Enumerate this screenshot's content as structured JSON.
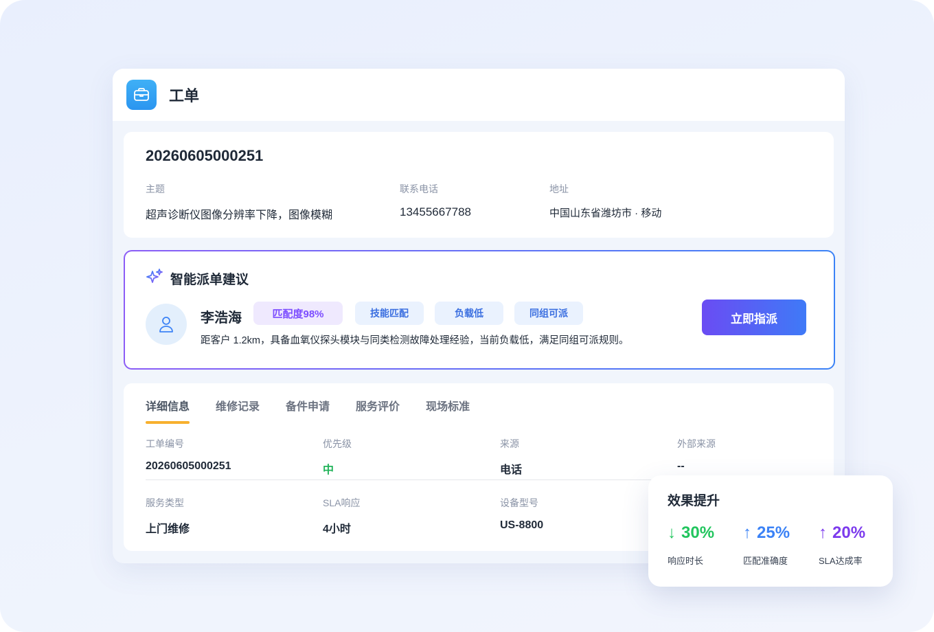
{
  "window": {
    "title": "工单"
  },
  "ticket": {
    "number": "20260605000251",
    "fields": [
      {
        "label": "主题",
        "value": "超声诊断仪图像分辨率下降，图像模糊"
      },
      {
        "label": "联系电话",
        "value": "13455667788"
      },
      {
        "label": "地址",
        "value": "中国山东省潍坊市 · 移动"
      }
    ]
  },
  "ai": {
    "title": "智能派单建议",
    "person": "李浩海",
    "match": "匹配度98%",
    "tags": [
      "技能匹配",
      "负载低",
      "同组可派"
    ],
    "description": "距客户 1.2km，具备血氧仪探头模块与同类检测故障处理经验，当前负载低，满足同组可派规则。",
    "button": "立即指派"
  },
  "tabs": [
    "详细信息",
    "维修记录",
    "备件申请",
    "服务评价",
    "现场标准"
  ],
  "details": {
    "row1": [
      {
        "label": "工单编号",
        "value": "20260605000251"
      },
      {
        "label": "优先级",
        "value": "中"
      },
      {
        "label": "来源",
        "value": "电话"
      },
      {
        "label": "外部来源",
        "value": "--"
      }
    ],
    "row2": [
      {
        "label": "服务类型",
        "value": "上门维修"
      },
      {
        "label": "SLA响应",
        "value": "4小时"
      },
      {
        "label": "设备型号",
        "value": "US-8800"
      }
    ]
  },
  "effect": {
    "title": "效果提升",
    "metrics": [
      {
        "arrow": "↓",
        "value": "30%",
        "label": "响应时长",
        "color": "#22c55e"
      },
      {
        "arrow": "↑",
        "value": "25%",
        "label": "匹配准确度",
        "color": "#3b82f6"
      },
      {
        "arrow": "↑",
        "value": "20%",
        "label": "SLA达成率",
        "color": "#7c3aed"
      }
    ]
  },
  "colors": {
    "accent_purple": "#7c4dff",
    "accent_blue": "#3b82f6",
    "tab_underline": "#f7b02e",
    "priority_green": "#22b35a"
  },
  "icons": {
    "app": "briefcase-icon",
    "ai": "sparkle-icon",
    "avatar": "user-icon"
  }
}
